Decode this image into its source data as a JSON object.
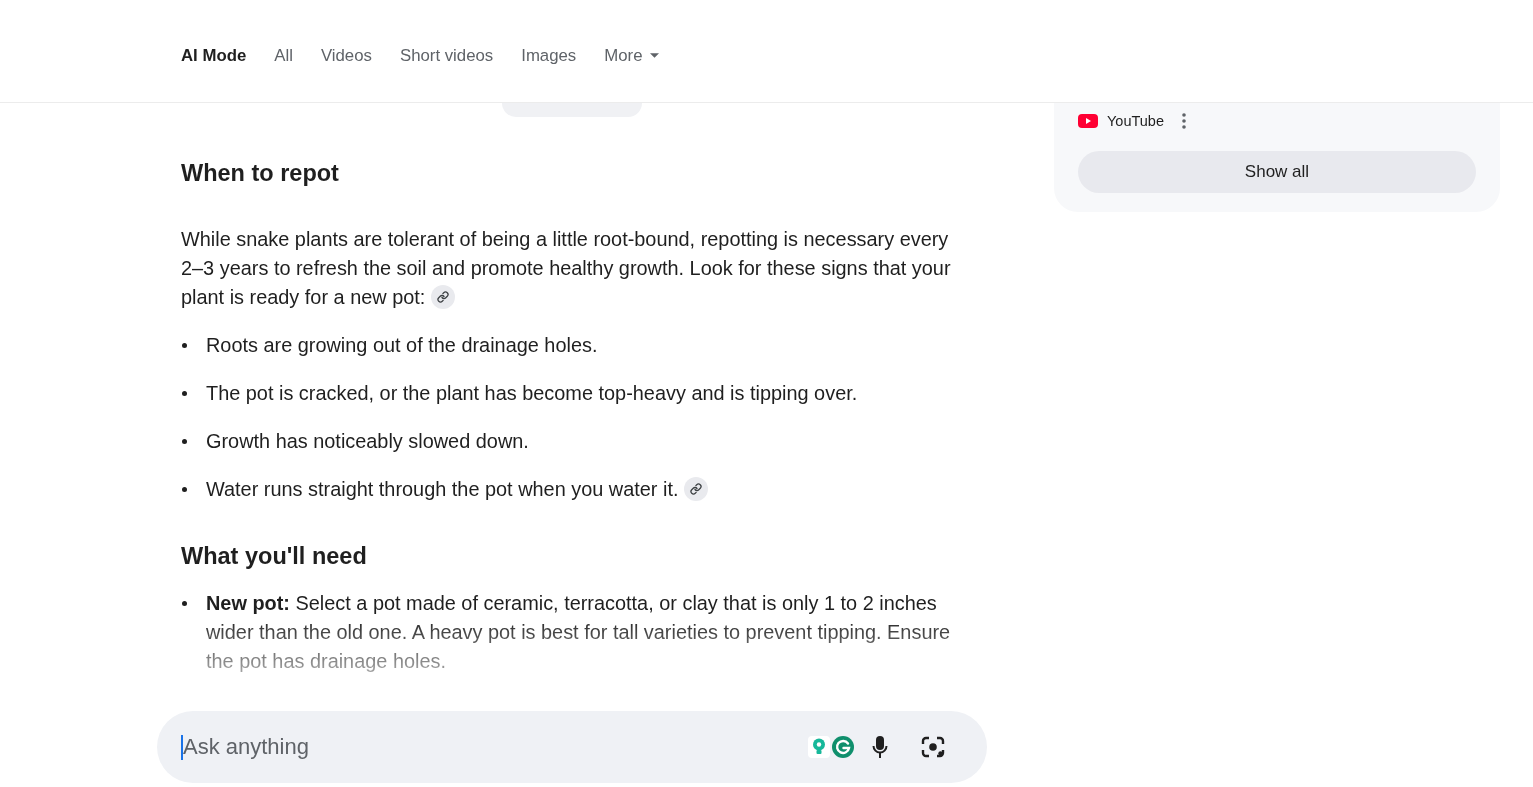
{
  "tabs": [
    {
      "label": "AI Mode",
      "selected": true,
      "kind": "tab"
    },
    {
      "label": "All",
      "selected": false,
      "kind": "tab"
    },
    {
      "label": "Videos",
      "selected": false,
      "kind": "tab"
    },
    {
      "label": "Short videos",
      "selected": false,
      "kind": "tab"
    },
    {
      "label": "Images",
      "selected": false,
      "kind": "tab"
    },
    {
      "label": "More",
      "selected": false,
      "kind": "menu"
    }
  ],
  "article": {
    "sections": [
      {
        "heading": "When to repot",
        "intro": {
          "text": "While snake plants are tolerant of being a little root-bound, repotting is necessary every 2–3 years to refresh the soil and promote healthy growth. Look for these signs that your plant is ready for a new pot:",
          "source_link": true
        },
        "bullets": [
          {
            "text": "Roots are growing out of the drainage holes.",
            "source_link": false
          },
          {
            "text": "The pot is cracked, or the plant has become top-heavy and is tipping over.",
            "source_link": false
          },
          {
            "text": "Growth has noticeably slowed down.",
            "source_link": false
          },
          {
            "text": "Water runs straight through the pot when you water it.",
            "source_link": true
          }
        ]
      },
      {
        "heading": "What you'll need",
        "bullets": [
          {
            "text": "**New pot:** Select a pot made of ceramic, terracotta, or clay that is only 1 to 2 inches wider than the old one. A heavy pot is best for tall varieties to prevent tipping. Ensure the pot has drainage holes.",
            "source_link": false
          }
        ]
      }
    ]
  },
  "sources_panel": {
    "sources": [
      {
        "name": "YouTube"
      }
    ],
    "button": "Show all"
  },
  "search": {
    "placeholder": "Ask anything",
    "focused": true
  }
}
